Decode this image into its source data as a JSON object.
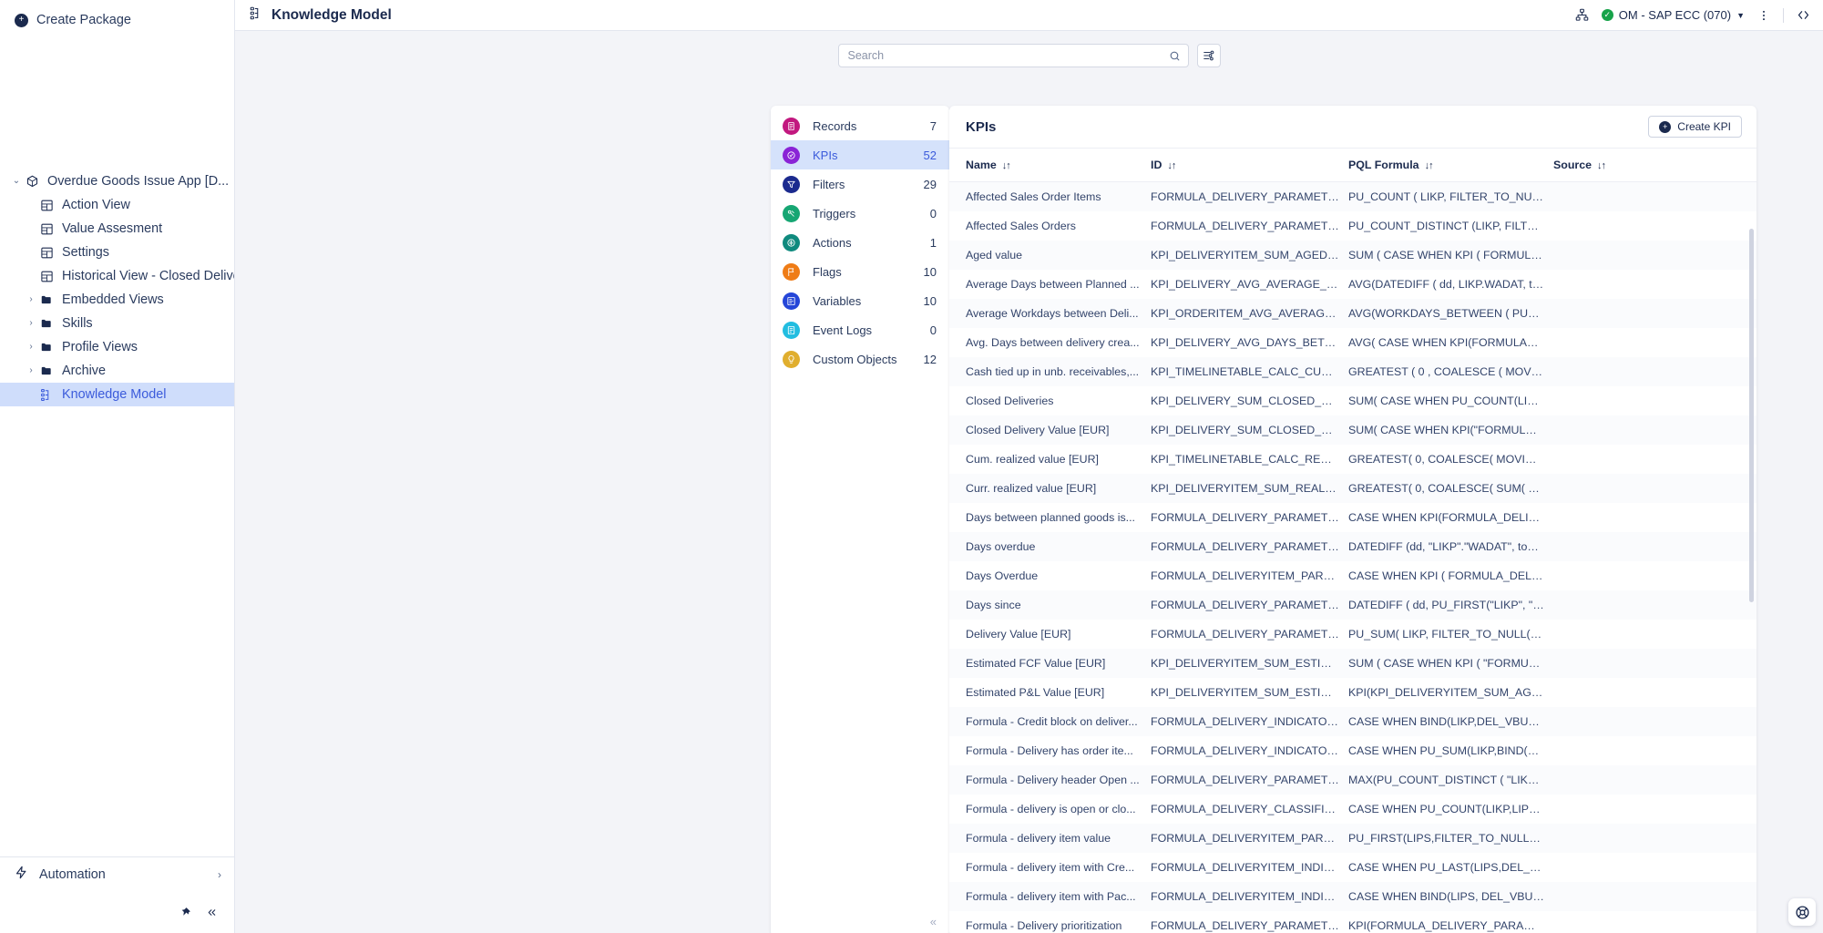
{
  "sidebar": {
    "create_package_label": "Create Package",
    "tree": [
      {
        "label": "Overdue Goods Issue App [D...",
        "icon": "package-icon",
        "chevron": "⌄",
        "indent": 0,
        "selected": false
      },
      {
        "label": "Action View",
        "icon": "view-icon",
        "chevron": "",
        "indent": 1,
        "selected": false
      },
      {
        "label": "Value Assesment",
        "icon": "view-icon",
        "chevron": "",
        "indent": 1,
        "selected": false
      },
      {
        "label": "Settings",
        "icon": "view-icon",
        "chevron": "",
        "indent": 1,
        "selected": false
      },
      {
        "label": "Historical View - Closed Deliveries",
        "icon": "view-icon",
        "chevron": "",
        "indent": 1,
        "selected": false
      },
      {
        "label": "Embedded Views",
        "icon": "folder-icon",
        "chevron": "›",
        "indent": 1,
        "selected": false
      },
      {
        "label": "Skills",
        "icon": "folder-icon",
        "chevron": "›",
        "indent": 1,
        "selected": false
      },
      {
        "label": "Profile Views",
        "icon": "folder-icon",
        "chevron": "›",
        "indent": 1,
        "selected": false
      },
      {
        "label": "Archive",
        "icon": "folder-icon",
        "chevron": "›",
        "indent": 1,
        "selected": false
      },
      {
        "label": "Knowledge Model",
        "icon": "knowledge-model-icon",
        "chevron": "",
        "indent": 1,
        "selected": true
      }
    ],
    "automation_label": "Automation",
    "automation_chevron": "›",
    "footer": {
      "pin": "pin-icon",
      "collapse": "«"
    }
  },
  "topbar": {
    "title": "Knowledge Model",
    "title_icon": "knowledge-model-icon",
    "share_icon": "org-chart-icon",
    "environment": "OM - SAP ECC (070)",
    "environment_status": "connected",
    "more_icon": "kebab-menu-icon",
    "code_icon": "code-brackets-icon"
  },
  "search": {
    "placeholder": "Search",
    "value": "",
    "icon": "search-icon",
    "filter_icon": "filter-settings-icon"
  },
  "categories": {
    "collapse_icon": "«",
    "items": [
      {
        "label": "Records",
        "count": "7",
        "color": "#c2187f",
        "icon": "records-icon",
        "active": false
      },
      {
        "label": "KPIs",
        "count": "52",
        "color": "#8a24d6",
        "icon": "kpis-icon",
        "active": true
      },
      {
        "label": "Filters",
        "count": "29",
        "color": "#1b2a8e",
        "icon": "filters-icon",
        "active": false
      },
      {
        "label": "Triggers",
        "count": "0",
        "color": "#16a673",
        "icon": "triggers-icon",
        "active": false
      },
      {
        "label": "Actions",
        "count": "1",
        "color": "#0f8a7e",
        "icon": "actions-icon",
        "active": false
      },
      {
        "label": "Flags",
        "count": "10",
        "color": "#ef7c16",
        "icon": "flags-icon",
        "active": false
      },
      {
        "label": "Variables",
        "count": "10",
        "color": "#2546d8",
        "icon": "variables-icon",
        "active": false
      },
      {
        "label": "Event Logs",
        "count": "0",
        "color": "#22bde0",
        "icon": "event-logs-icon",
        "active": false
      },
      {
        "label": "Custom Objects",
        "count": "12",
        "color": "#e0ae2e",
        "icon": "custom-objects-icon",
        "active": false
      }
    ]
  },
  "kpi_panel": {
    "title": "KPIs",
    "create_button_label": "Create KPI",
    "columns": [
      {
        "label": "Name",
        "sort": "↓↑",
        "sorted": true
      },
      {
        "label": "ID",
        "sort": "↓↑",
        "sorted": false
      },
      {
        "label": "PQL Formula",
        "sort": "↓↑",
        "sorted": false
      },
      {
        "label": "Source",
        "sort": "↓↑",
        "sorted": false
      }
    ],
    "rows": [
      {
        "name": "Affected Sales Order Items",
        "id": "FORMULA_DELIVERY_PARAMETER_...",
        "pql": "PU_COUNT ( LIKP, FILTER_TO_NULL(...",
        "source": ""
      },
      {
        "name": "Affected Sales Orders",
        "id": "FORMULA_DELIVERY_PARAMETER_...",
        "pql": "PU_COUNT_DISTINCT (LIKP, FILTER_...",
        "source": ""
      },
      {
        "name": "Aged value",
        "id": "KPI_DELIVERYITEM_SUM_AGED_VAL...",
        "pql": "SUM ( CASE WHEN KPI ( FORMULA_...",
        "source": ""
      },
      {
        "name": "Average Days between Planned ...",
        "id": "KPI_DELIVERY_AVG_AVERAGE_DAYS...",
        "pql": "AVG(DATEDIFF ( dd, LIKP.WADAT, to...",
        "source": ""
      },
      {
        "name": "Average Workdays between Deli...",
        "id": "KPI_ORDERITEM_AVG_AVERAGE_WO...",
        "pql": "AVG(WORKDAYS_BETWEEN ( PU_FI...",
        "source": ""
      },
      {
        "name": "Avg. Days between delivery crea...",
        "id": "KPI_DELIVERY_AVG_DAYS_BETWEE...",
        "pql": "AVG( CASE WHEN KPI(FORMULA_D...",
        "source": ""
      },
      {
        "name": "Cash tied up in unb. receivables,...",
        "id": "KPI_TIMELINETABLE_CALC_CUMUL...",
        "pql": "GREATEST ( 0 , COALESCE ( MOVIN...",
        "source": ""
      },
      {
        "name": "Closed Deliveries",
        "id": "KPI_DELIVERY_SUM_CLOSED_DELIV...",
        "pql": "SUM( CASE WHEN PU_COUNT(LIKP,...",
        "source": ""
      },
      {
        "name": "Closed Delivery Value [EUR]",
        "id": "KPI_DELIVERY_SUM_CLOSED_DELIV...",
        "pql": "SUM( CASE WHEN KPI(\"FORMULA_...",
        "source": ""
      },
      {
        "name": "Cum. realized value [EUR]",
        "id": "KPI_TIMELINETABLE_CALC_REALIZE...",
        "pql": "GREATEST( 0, COALESCE( MOVING_...",
        "source": ""
      },
      {
        "name": "Curr. realized value [EUR]",
        "id": "KPI_DELIVERYITEM_SUM_REALIZED...",
        "pql": "GREATEST( 0, COALESCE( SUM( CA...",
        "source": ""
      },
      {
        "name": "Days between planned goods is...",
        "id": "FORMULA_DELIVERY_PARAMETER_...",
        "pql": "CASE WHEN KPI(FORMULA_DELIVE...",
        "source": ""
      },
      {
        "name": "Days overdue",
        "id": "FORMULA_DELIVERY_PARAMETER_...",
        "pql": "DATEDIFF (dd, \"LIKP\".\"WADAT\", toda...",
        "source": ""
      },
      {
        "name": "Days Overdue",
        "id": "FORMULA_DELIVERYITEM_PARAME...",
        "pql": "CASE WHEN KPI ( FORMULA_DELIV...",
        "source": ""
      },
      {
        "name": "Days since",
        "id": "FORMULA_DELIVERY_PARAMETER_...",
        "pql": "DATEDIFF ( dd, PU_FIRST(\"LIKP\", \"LI...",
        "source": ""
      },
      {
        "name": "Delivery Value [EUR]",
        "id": "FORMULA_DELIVERY_PARAMETER_...",
        "pql": "PU_SUM( LIKP, FILTER_TO_NULL(KPI...",
        "source": ""
      },
      {
        "name": "Estimated FCF Value [EUR]",
        "id": "KPI_DELIVERYITEM_SUM_ESTIMATE...",
        "pql": "SUM ( CASE WHEN KPI ( \"FORMULA...",
        "source": ""
      },
      {
        "name": "Estimated P&L Value [EUR]",
        "id": "KPI_DELIVERYITEM_SUM_ESTIMATE...",
        "pql": "KPI(KPI_DELIVERYITEM_SUM_AGED...",
        "source": ""
      },
      {
        "name": "Formula - Credit block on deliver...",
        "id": "FORMULA_DELIVERY_INDICATOR_C...",
        "pql": "CASE WHEN BIND(LIKP,DEL_VBUK....",
        "source": ""
      },
      {
        "name": "Formula - Delivery has order ite...",
        "id": "FORMULA_DELIVERY_INDICATOR_M...",
        "pql": "CASE WHEN PU_SUM(LIKP,BIND(VB...",
        "source": ""
      },
      {
        "name": "Formula - Delivery header Open ...",
        "id": "FORMULA_DELIVERY_PARAMETER_...",
        "pql": "MAX(PU_COUNT_DISTINCT ( \"LIKP\", ...",
        "source": ""
      },
      {
        "name": "Formula - delivery is open or clo...",
        "id": "FORMULA_DELIVERY_CLASSIFICATI...",
        "pql": "CASE WHEN PU_COUNT(LIKP,LIPS....",
        "source": ""
      },
      {
        "name": "Formula - delivery item value",
        "id": "FORMULA_DELIVERYITEM_PARAME...",
        "pql": "PU_FIRST(LIPS,FILTER_TO_NULL(BI...",
        "source": ""
      },
      {
        "name": "Formula - delivery item with Cre...",
        "id": "FORMULA_DELIVERYITEM_INDICAT...",
        "pql": "CASE WHEN PU_LAST(LIPS,DEL_VB...",
        "source": ""
      },
      {
        "name": "Formula - delivery item with Pac...",
        "id": "FORMULA_DELIVERYITEM_INDICAT...",
        "pql": "CASE WHEN BIND(LIPS, DEL_VBUP....",
        "source": ""
      },
      {
        "name": "Formula - Delivery prioritization",
        "id": "FORMULA_DELIVERY_PARAMETER_...",
        "pql": "KPI(FORMULA_DELIVERY_PARAMET...",
        "source": ""
      }
    ]
  },
  "help": {
    "icon": "lifebuoy-icon"
  }
}
